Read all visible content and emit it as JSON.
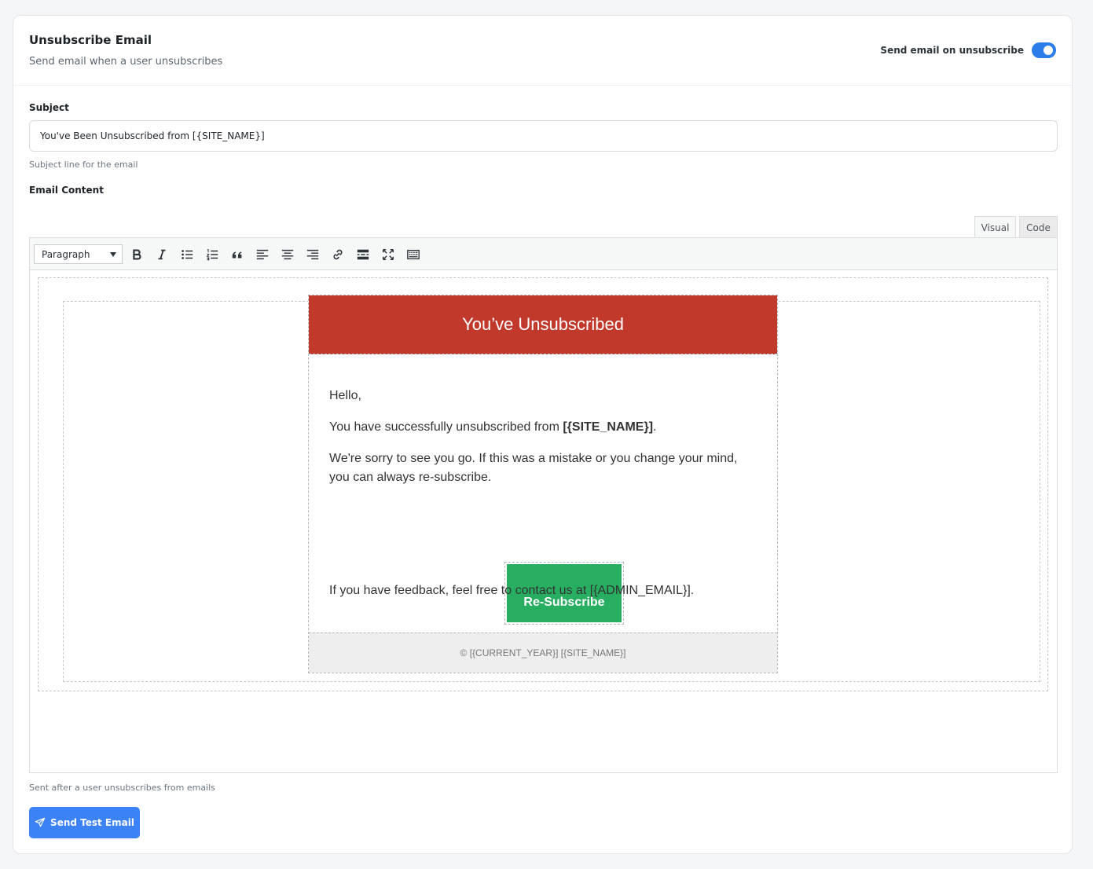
{
  "header": {
    "title": "Unsubscribe Email",
    "subtitle": "Send email when a user unsubscribes",
    "toggle_label": "Send email on unsubscribe",
    "toggle_on": true
  },
  "subject": {
    "label": "Subject",
    "value": "You've Been Unsubscribed from [{SITE_NAME}]",
    "help": "Subject line for the email"
  },
  "content": {
    "label": "Email Content",
    "help": "Sent after a user unsubscribes from emails"
  },
  "editor": {
    "tabs": [
      "Visual",
      "Code"
    ],
    "active_tab": "Visual",
    "format_select": "Paragraph",
    "toolbar_icons": [
      "bold-icon",
      "italic-icon",
      "bullet-list-icon",
      "numbered-list-icon",
      "blockquote-icon",
      "align-left-icon",
      "align-center-icon",
      "align-right-icon",
      "link-icon",
      "read-more-icon",
      "fullscreen-icon",
      "toolbar-toggle-icon"
    ]
  },
  "email": {
    "header_title": "You’ve Unsubscribed",
    "greeting": "Hello,",
    "success_prefix": "You have successfully unsubscribed from ",
    "site_name": "[{SITE_NAME}]",
    "success_suffix": ".",
    "sorry_text": "We're sorry to see you go. If this was a mistake or you change your mind, you can always re-subscribe.",
    "button_label": "Re-Subscribe",
    "feedback_text": "If you have feedback, feel free to contact us at [{ADMIN_EMAIL}].",
    "footer_text": "© [{CURRENT_YEAR}] [{SITE_NAME}]",
    "colors": {
      "header": "#c0392b",
      "button": "#27ae60",
      "footer": "#eeeeee"
    }
  },
  "actions": {
    "send_test_label": "Send Test Email",
    "accent": "#3b82f6"
  }
}
